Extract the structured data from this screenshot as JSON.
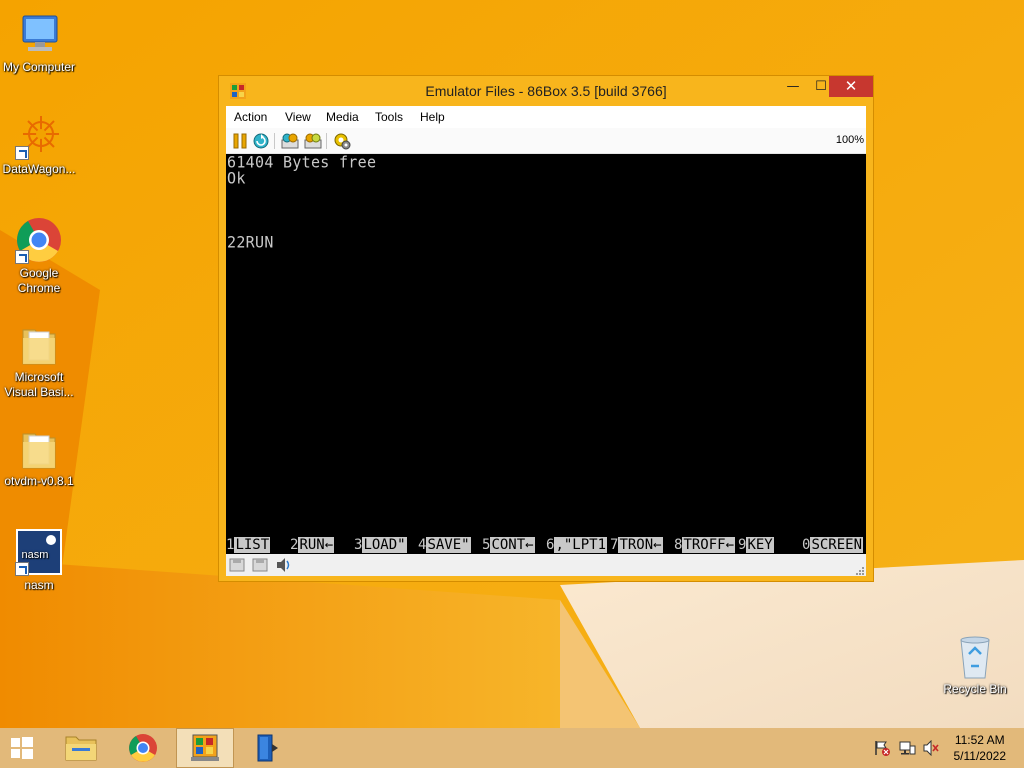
{
  "desktop": {
    "icons": [
      {
        "label": "My Computer"
      },
      {
        "label": "DataWagon..."
      },
      {
        "label": "Google Chrome"
      },
      {
        "label": "Microsoft Visual Basi..."
      },
      {
        "label": "otvdm-v0.8.1"
      },
      {
        "label": "nasm"
      },
      {
        "label": "Recycle Bin"
      }
    ],
    "nasm_icon_text": "nasm"
  },
  "window": {
    "title": "Emulator Files - 86Box 3.5 [build 3766]",
    "controls": {
      "minimize": "—",
      "maximize": "☐",
      "close": "✕"
    },
    "menu": [
      "Action",
      "View",
      "Media",
      "Tools",
      "Help"
    ],
    "toolbar": {
      "buttons": [
        "pause-icon",
        "reset-icon",
        "ctrl-alt-del-icon",
        "ctrl-alt-esc-icon",
        "settings-icon"
      ],
      "zoom": "100%"
    },
    "screen": {
      "lines": [
        "61404 Bytes free",
        "Ok",
        "",
        "",
        "22RUN"
      ],
      "function_keys": [
        {
          "num": "1",
          "text": "LIST"
        },
        {
          "num": "2",
          "text": "RUN←"
        },
        {
          "num": "3",
          "text": "LOAD\""
        },
        {
          "num": "4",
          "text": "SAVE\""
        },
        {
          "num": "5",
          "text": "CONT←"
        },
        {
          "num": "6",
          "text": ",\"LPT1"
        },
        {
          "num": "7",
          "text": "TRON←"
        },
        {
          "num": "8",
          "text": "TROFF←"
        },
        {
          "num": "9",
          "text": "KEY"
        },
        {
          "num": "0",
          "text": "SCREEN"
        }
      ]
    },
    "statusbar": [
      "floppy-drive-icon",
      "floppy-drive-icon",
      "sound-icon"
    ]
  },
  "taskbar": {
    "items": [
      "start-button",
      "file-explorer",
      "google-chrome",
      "86box",
      "app-blue-door"
    ],
    "tray": [
      "action-center-flag-icon",
      "network-icon",
      "volume-muted-icon"
    ],
    "time": "11:52 AM",
    "date": "5/11/2022"
  },
  "colors": {
    "desktop": "#f6a800",
    "window_frame": "#f8b51c",
    "close_button": "#c7372f",
    "screen_bg": "#000000",
    "screen_text": "#c8c8c8",
    "taskbar": "#e2b97a"
  }
}
